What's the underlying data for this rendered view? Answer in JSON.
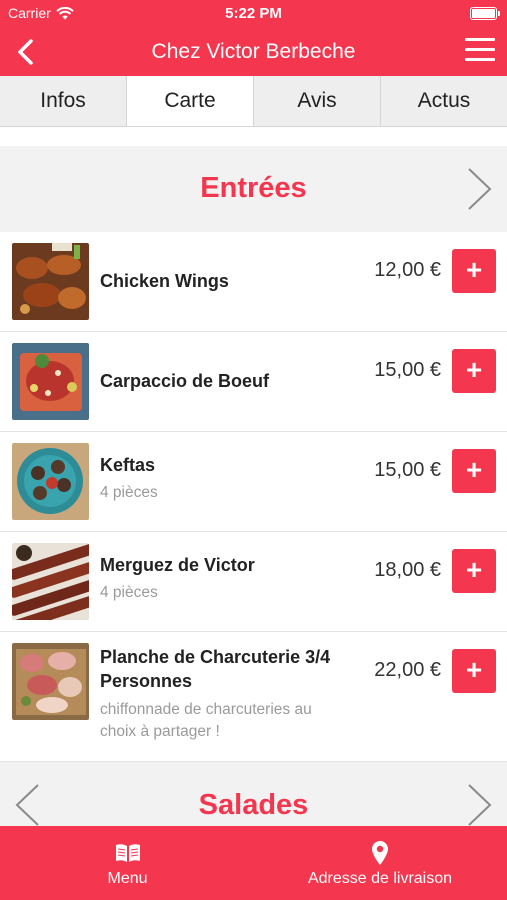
{
  "status_bar": {
    "carrier": "Carrier",
    "time": "5:22 PM"
  },
  "header": {
    "title": "Chez Victor Berbeche"
  },
  "tabs": [
    {
      "label": "Infos",
      "active": false
    },
    {
      "label": "Carte",
      "active": true
    },
    {
      "label": "Avis",
      "active": false
    },
    {
      "label": "Actus",
      "active": false
    }
  ],
  "sections": [
    {
      "title": "Entrées",
      "items": [
        {
          "name": "Chicken Wings",
          "description": "",
          "price": "12,00 €",
          "add": "+"
        },
        {
          "name": "Carpaccio de Boeuf",
          "description": "",
          "price": "15,00 €",
          "add": "+"
        },
        {
          "name": "Keftas",
          "description": "4 pièces",
          "price": "15,00 €",
          "add": "+"
        },
        {
          "name": "Merguez de Victor",
          "description": "4 pièces",
          "price": "18,00 €",
          "add": "+"
        },
        {
          "name": "Planche de Charcuterie 3/4 Personnes",
          "description": "chiffonnade de charcuteries au choix à partager !",
          "price": "22,00 €",
          "add": "+"
        }
      ]
    },
    {
      "title": "Salades"
    }
  ],
  "bottom_nav": [
    {
      "label": "Menu",
      "icon": "book-icon"
    },
    {
      "label": "Adresse de livraison",
      "icon": "location-pin-icon"
    }
  ],
  "colors": {
    "brand": "#f5364f",
    "section_bg": "#f2f2f2",
    "tab_bg": "#eeeeee"
  }
}
